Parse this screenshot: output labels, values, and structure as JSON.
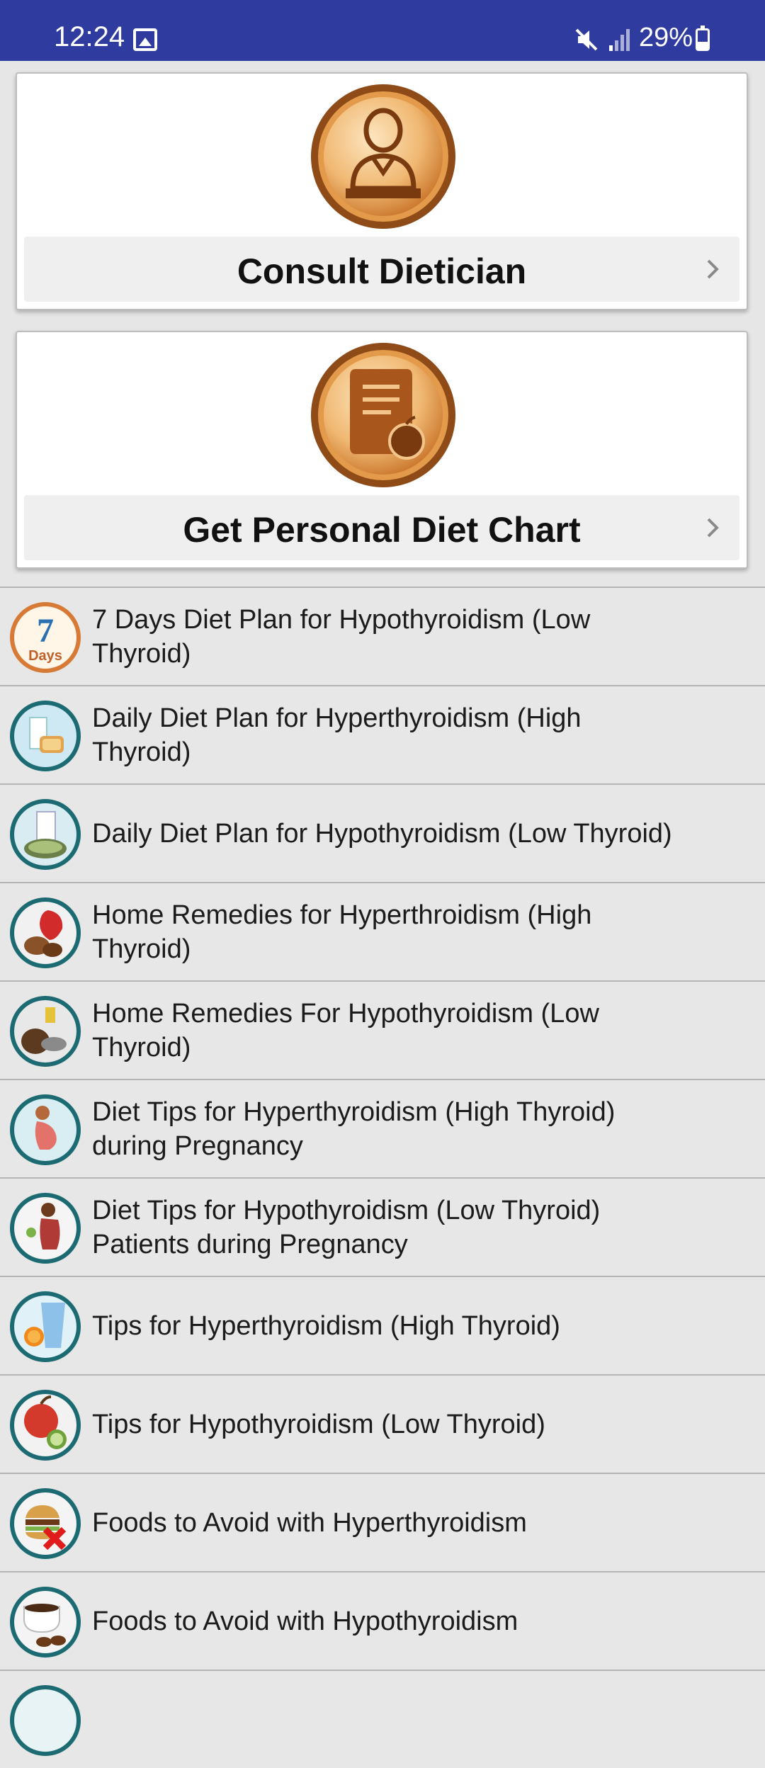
{
  "status_bar": {
    "time": "12:24",
    "battery": "29%",
    "icons": [
      "gallery-icon",
      "mute-icon",
      "signal-icon",
      "battery-icon"
    ]
  },
  "cards": [
    {
      "label": "Consult Dietician",
      "icon": "dietician-icon"
    },
    {
      "label": "Get Personal Diet Chart",
      "icon": "diet-chart-icon"
    }
  ],
  "list": [
    {
      "label": "7 Days Diet Plan for Hypothyroidism (Low Thyroid)",
      "icon": "seven-days-icon",
      "icon_text": "7",
      "icon_subtext": "Days"
    },
    {
      "label": "Daily Diet Plan for Hyperthyroidism (High Thyroid)",
      "icon": "milk-toast-icon"
    },
    {
      "label": "Daily Diet Plan for Hypothyroidism (Low Thyroid)",
      "icon": "milk-seeds-icon"
    },
    {
      "label": "Home Remedies for Hyperthroidism (High Thyroid)",
      "icon": "strawberry-nuts-icon"
    },
    {
      "label": "Home Remedies For Hypothyroidism (Low Thyroid)",
      "icon": "coconut-oil-icon"
    },
    {
      "label": "Diet Tips for Hyperthyroidism (High Thyroid) during Pregnancy",
      "icon": "pregnant-woman-icon"
    },
    {
      "label": "Diet Tips for Hypothyroidism (Low Thyroid) Patients during Pregnancy",
      "icon": "pregnant-eating-icon"
    },
    {
      "label": "Tips for Hyperthyroidism (High Thyroid)",
      "icon": "water-orange-icon"
    },
    {
      "label": "Tips for Hypothyroidism (Low Thyroid)",
      "icon": "apple-cucumber-icon"
    },
    {
      "label": "Foods to Avoid with Hyperthyroidism",
      "icon": "burger-fries-avoid-icon"
    },
    {
      "label": "Foods to Avoid with Hypothyroidism",
      "icon": "coffee-avoid-icon"
    }
  ],
  "colors": {
    "status_bar": "#2f3b9f",
    "orange_accent": "#d98535",
    "teal_ring": "#1e7f86"
  }
}
